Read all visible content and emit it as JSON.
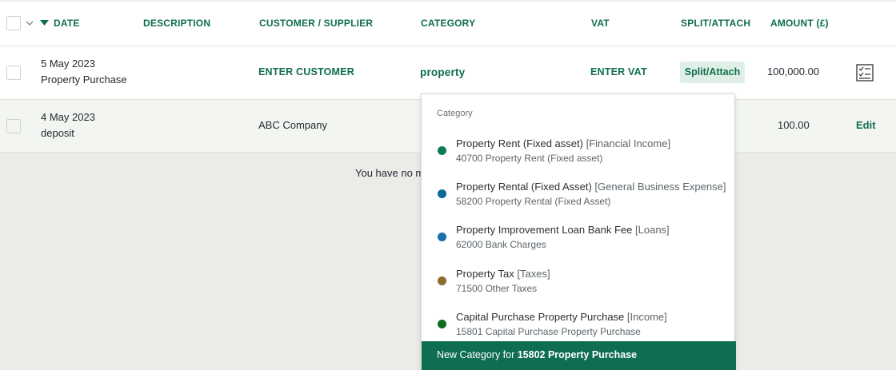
{
  "header": {
    "date": "DATE",
    "description": "DESCRIPTION",
    "customer": "CUSTOMER / SUPPLIER",
    "category": "CATEGORY",
    "vat": "VAT",
    "split": "SPLIT/ATTACH",
    "amount": "AMOUNT (£)"
  },
  "rows": [
    {
      "date": "5 May 2023",
      "desc": "Property Purchase",
      "customer": "ENTER CUSTOMER",
      "category": "property",
      "vat": "ENTER VAT",
      "split": "Split/Attach",
      "amount": "100,000.00",
      "action_icon": "checklist-icon"
    },
    {
      "date": "4 May 2023",
      "desc": "deposit",
      "customer": "ABC Company",
      "amount": "100.00",
      "action": "Edit"
    }
  ],
  "notice": "You have no m",
  "dropdown": {
    "title": "Category",
    "items": [
      {
        "name": "Property Rent (Fixed asset)",
        "group": "[Financial Income]",
        "code": "40700 Property Rent (Fixed asset)",
        "color": "#0f7a5a"
      },
      {
        "name": "Property Rental (Fixed Asset)",
        "group": "[General Business Expense]",
        "code": "58200 Property Rental (Fixed Asset)",
        "color": "#0b6a9a"
      },
      {
        "name": "Property Improvement Loan Bank Fee",
        "group": "[Loans]",
        "code": "62000 Bank Charges",
        "color": "#1a6fb0"
      },
      {
        "name": "Property Tax",
        "group": "[Taxes]",
        "code": "71500 Other Taxes",
        "color": "#8d6a2a"
      },
      {
        "name": "Capital Purchase Property Purchase",
        "group": "[Income]",
        "code": "15801 Capital Purchase Property Purchase",
        "color": "#0f6d1c"
      }
    ],
    "new_prefix": "New Category for ",
    "new_value": "15802 Property Purchase"
  }
}
